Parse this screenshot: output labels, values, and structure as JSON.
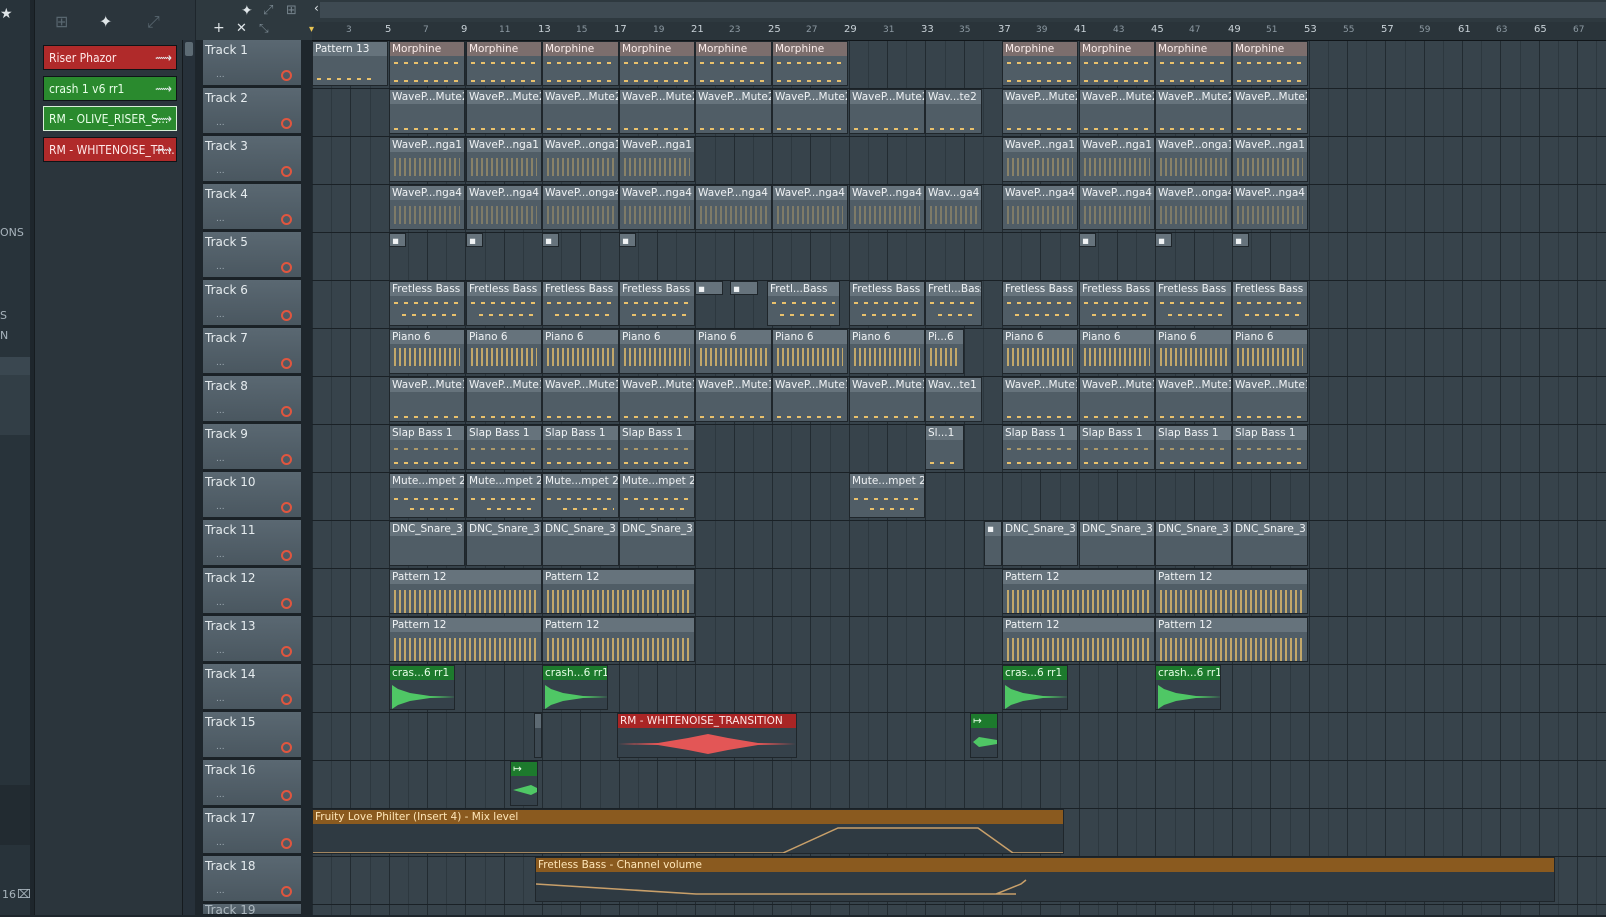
{
  "left_panel": {
    "labels": [
      "ONS",
      "S",
      "N"
    ],
    "bottom_number": "16"
  },
  "picker": {
    "clips": [
      {
        "label": "Riser Phazor",
        "color": "#b02a2a"
      },
      {
        "label": "crash 1 v6 rr1",
        "color": "#2a8a2e"
      },
      {
        "label": "RM - OLIVE_RISER_S...",
        "color": "#2a8a2e"
      },
      {
        "label": "RM - WHITENOISE_TR...",
        "color": "#b02a2a"
      }
    ]
  },
  "timeline": {
    "bar_numbers": [
      "3",
      "5",
      "7",
      "9",
      "11",
      "13",
      "15",
      "17",
      "19",
      "21",
      "23",
      "25",
      "27",
      "29",
      "31",
      "33",
      "35",
      "37",
      "39",
      "41",
      "43",
      "45",
      "47",
      "49",
      "51",
      "53",
      "55",
      "57",
      "59",
      "61",
      "63",
      "65",
      "67"
    ]
  },
  "tracks": [
    "Track 1",
    "Track 2",
    "Track 3",
    "Track 4",
    "Track 5",
    "Track 6",
    "Track 7",
    "Track 8",
    "Track 9",
    "Track 10",
    "Track 11",
    "Track 12",
    "Track 13",
    "Track 14",
    "Track 15",
    "Track 16",
    "Track 17",
    "Track 18",
    "Track 19"
  ],
  "patterns": {
    "pattern13": "Pattern 13",
    "morphine": "Morphine",
    "wave_mute2": "WaveP...Mute2",
    "wave_mute2_short": "Wav...te2",
    "wave_nga1": "WaveP...nga1",
    "wave_onga1": "WaveP...onga1",
    "wave_nga4": "WaveP...nga4",
    "wave_onga4": "WaveP...onga4",
    "wave_nga4_short": "Wav...ga4",
    "fretless": "Fretless Bass",
    "fretless_short": "Fretl...Bass",
    "piano": "Piano 6",
    "piano_short": "Pi...6",
    "wave_mute1": "WaveP...Mute1",
    "wave_mute1_short": "Wav...te1",
    "slap": "Slap Bass 1",
    "slap_short": "Sl...1",
    "mute_trumpet": "Mute...mpet 2",
    "snare": "DNC_Snare_3",
    "pattern12": "Pattern 12",
    "crash_a": "cras...6 rr1",
    "crash_b": "crash...6 rr1",
    "whitenoise": "RM - WHITENOISE_TRANSITION",
    "auto17": "Fruity Love Philter (Insert 4) - Mix level",
    "auto18": "Fretless Bass - Channel volume"
  }
}
